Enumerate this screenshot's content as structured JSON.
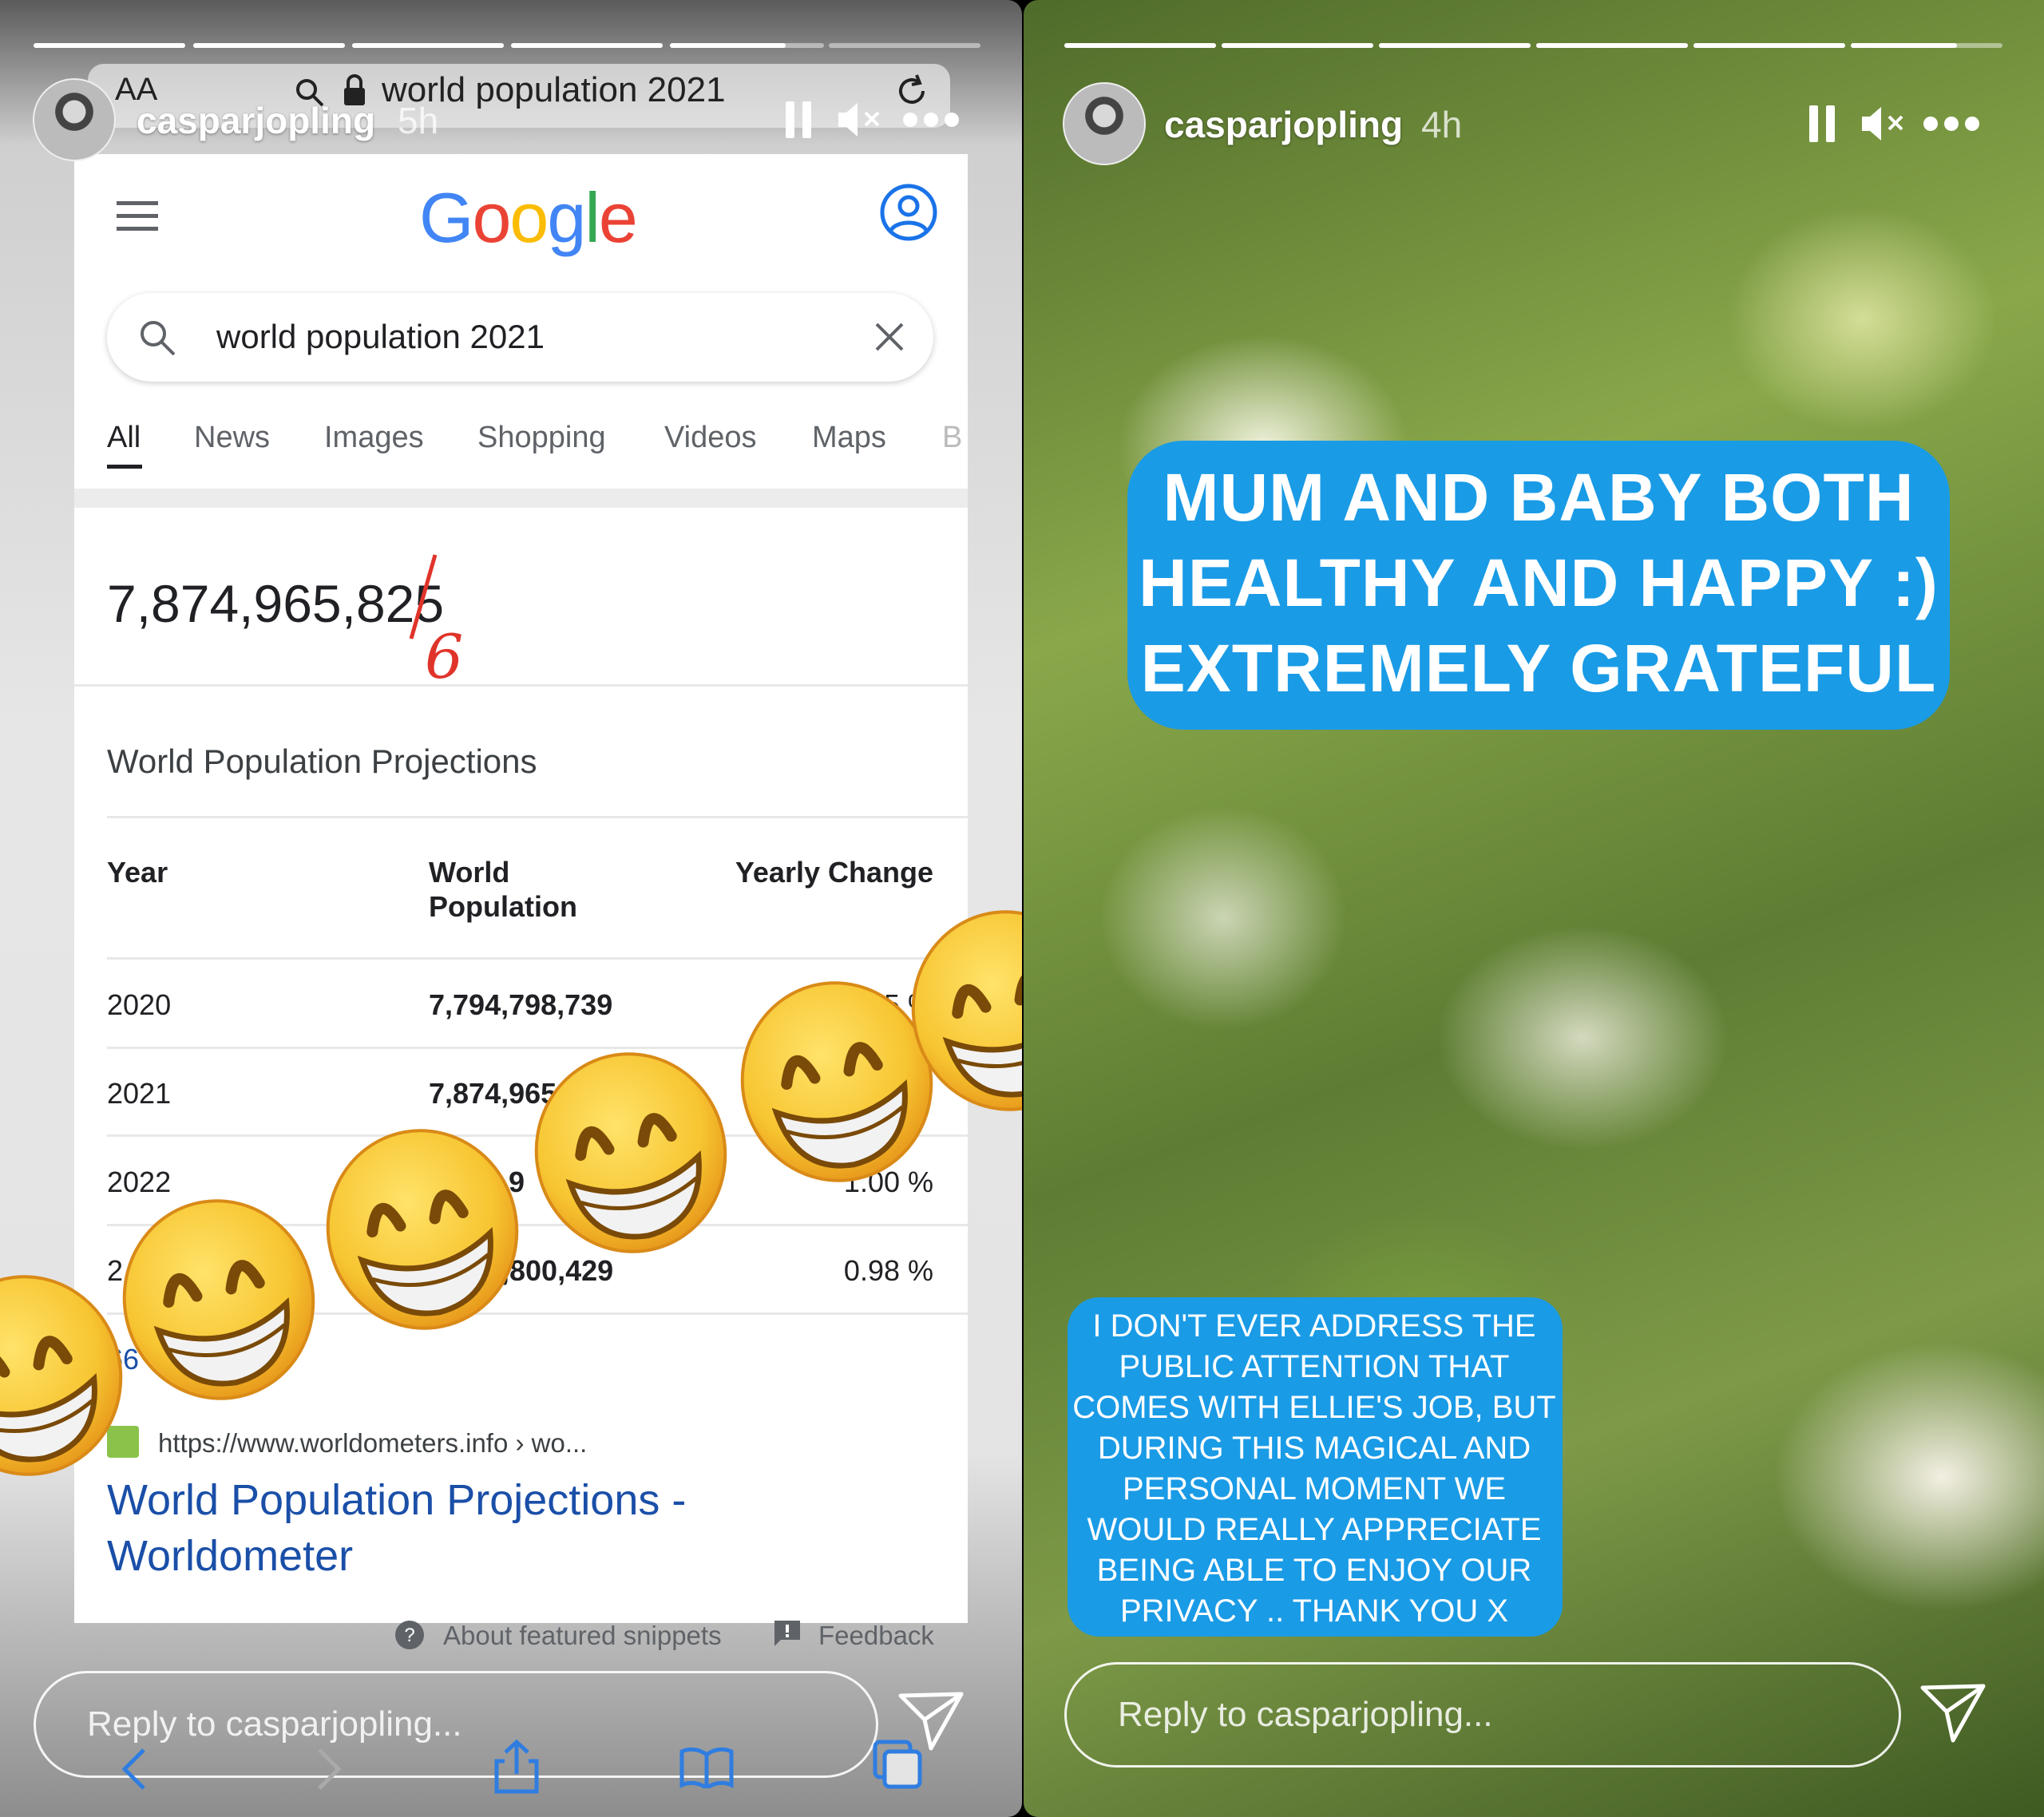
{
  "left_story": {
    "username": "casparjopling",
    "time": "5h",
    "progress_segments": [
      1,
      1,
      1,
      1,
      0.75,
      0
    ],
    "safari": {
      "text_size": "AA",
      "url": "world population 2021"
    },
    "google": {
      "logo": "Google",
      "search_value": "world population 2021",
      "tabs": [
        "All",
        "News",
        "Images",
        "Shopping",
        "Videos",
        "Maps",
        "B"
      ],
      "active_tab": "All",
      "result_number": "7,874,965,825",
      "handwritten_correction": "6",
      "table_title": "World Population Projections",
      "headers": {
        "year": "Year",
        "pop_1": "World",
        "pop_2": "Population",
        "change": "Yearly Change"
      },
      "rows": [
        {
          "year": "2020",
          "population": "7,794,798,739",
          "change": "5 %"
        },
        {
          "year": "2021",
          "population": "7,874,965",
          "change": ""
        },
        {
          "year": "2022",
          "population": "9",
          "change": "1.00 %"
        },
        {
          "year": "2",
          "population": ",800,429",
          "change": "0.98 %"
        }
      ],
      "more_link": "66",
      "source_url": "https://www.worldometers.info › wo...",
      "result_title_1": "World Population Projections -",
      "result_title_2": "Worldometer",
      "about_snippets": "About featured snippets",
      "feedback": "Feedback"
    },
    "reply_placeholder": "Reply to casparjopling...",
    "emoji": "beaming-face-with-smiling-eyes"
  },
  "right_story": {
    "username": "casparjopling",
    "time": "4h",
    "progress_segments": [
      1,
      1,
      1,
      1,
      1,
      0.7
    ],
    "headline": [
      "MUM AND BABY BOTH",
      "HEALTHY AND HAPPY :)",
      "EXTREMELY GRATEFUL"
    ],
    "message": [
      "I DON'T EVER ADDRESS THE",
      "PUBLIC ATTENTION THAT",
      "COMES WITH ELLIE'S JOB, BUT",
      "DURING THIS MAGICAL AND",
      "PERSONAL MOMENT WE",
      "WOULD REALLY APPRECIATE",
      "BEING ABLE TO ENJOY OUR",
      "PRIVACY .. THANK YOU X"
    ],
    "reply_placeholder": "Reply to casparjopling..."
  },
  "colors": {
    "caption_blue": "#1a9be6",
    "google_blue": "#1a0dab",
    "link_blue": "#1a4fa8",
    "correction_red": "#e0342a",
    "emoji_yellow": "#f7c531"
  }
}
